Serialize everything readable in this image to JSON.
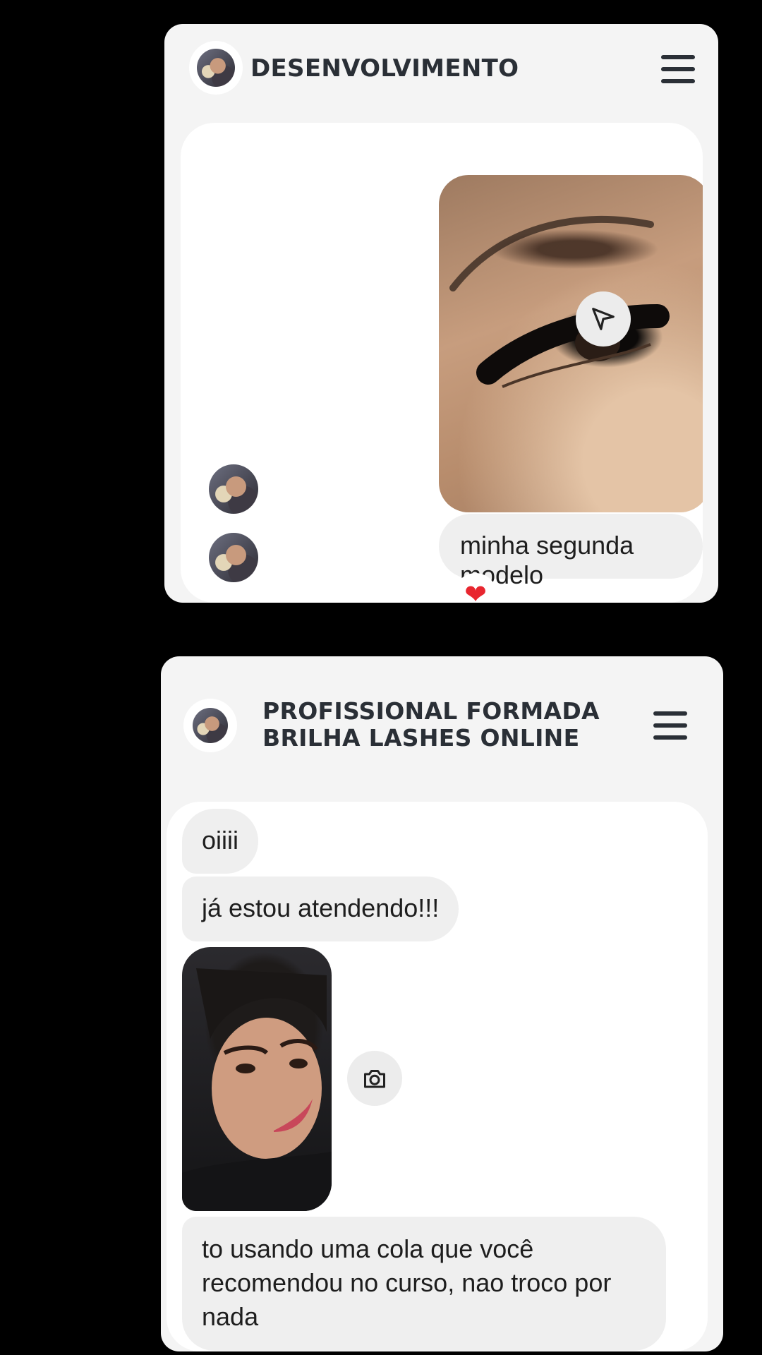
{
  "cards": [
    {
      "title": "DESENVOLVIMENTO",
      "messages": {
        "text": "minha segunda modelo",
        "reaction": "❤"
      },
      "icons": {
        "menu": "menu-icon",
        "share": "send-icon"
      }
    },
    {
      "title_line1": "PROFISSIONAL FORMADA",
      "title_line2": "BRILHA LASHES ONLINE",
      "messages": {
        "m1": "oiiii",
        "m2": "já estou atendendo!!!",
        "m3_line1": "to usando uma cola que você",
        "m3_line2": "recomendou no curso, nao troco por",
        "m3_line3": "nada"
      },
      "icons": {
        "menu": "menu-icon",
        "camera": "camera-icon"
      }
    }
  ],
  "colors": {
    "background": "#000000",
    "card": "#f4f4f4",
    "bubble": "#efefef",
    "title": "#2a2f36",
    "heart": "#e8262f"
  }
}
